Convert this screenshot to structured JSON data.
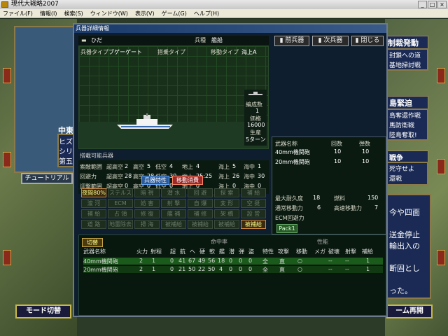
{
  "window": {
    "title": "現代大戦略2007"
  },
  "menu": [
    "ファイル(F)",
    "情報(I)",
    "検索(S)",
    "ウィンドウ(W)",
    "表示(V)",
    "ゲーム(G)",
    "ヘルプ(H)"
  ],
  "dialog": {
    "title": "兵器詳細情報",
    "name": "ひだ",
    "type_label": "兵種",
    "type_value": "艦船",
    "weapon_type_label": "兵器タイプ",
    "weapon_type_value": "ブゲーゲート",
    "board_type_label": "搭乗タイプ",
    "move_type_label": "移動タイプ",
    "move_type_value": "海上A",
    "formation_label": "編成数",
    "formation_value": "1",
    "price_label": "価格",
    "price_value": "16000",
    "production_label": "生産",
    "production_value": "5ターン",
    "carry_label": "搭載可能兵器",
    "prev_button": "前兵器",
    "next_button": "次兵器",
    "close_button": "閉じる"
  },
  "stats": [
    {
      "label": "索敵範囲",
      "a": "超高空",
      "av": "2",
      "b": "高空",
      "bv": "5",
      "c": "低空",
      "cv": "4",
      "d": "地上",
      "dv": "4",
      "e": "海上",
      "ev": "5",
      "f": "海中",
      "fv": "1"
    },
    {
      "label": "回避力",
      "a": "超高空",
      "av": "28",
      "b": "高空",
      "bv": "28",
      "c": "低空",
      "cv": "30",
      "d": "地上",
      "dv": "25:25",
      "e": "海上",
      "ev": "26",
      "f": "海中",
      "fv": "30"
    },
    {
      "label": "迎撃範囲",
      "a": "超高空",
      "av": "0",
      "b": "高空",
      "bv": "0",
      "c": "低空",
      "cv": "0",
      "d": "地上",
      "dv": "0",
      "e": "海上",
      "ev": "0",
      "f": "海中",
      "fv": "0"
    }
  ],
  "tabs": {
    "spec": "兵器特性",
    "move_cost": "移動消費"
  },
  "chips": [
    [
      "夜間80%",
      "ステルス",
      "暗 視",
      "潜 水",
      "回 避",
      "探 索",
      "補 給"
    ],
    [
      "渡 河",
      "ECM",
      "妨 害",
      "射 撃",
      "自 爆",
      "変 形",
      "空 挺"
    ],
    [
      "補 給",
      "占 領",
      "修 復",
      "艦 補",
      "補 修",
      "架 橋",
      "設 営"
    ],
    [
      "道 路",
      "地雷除去",
      "掃 海",
      "被補給",
      "被補給",
      "被補給",
      "被補給"
    ]
  ],
  "weapons_summary": {
    "headers": [
      "武器名称",
      "回数",
      "弾数"
    ],
    "rows": [
      [
        "40mm機関砲",
        "10",
        "10"
      ],
      [
        "20mm機関砲",
        "10",
        "10"
      ]
    ],
    "durability_label": "最大耐久度",
    "durability_value": "18",
    "fuel_label": "燃料",
    "fuel_value": "150",
    "normal_move_label": "通常移動力",
    "normal_move_value": "6",
    "fast_move_label": "高速移動力",
    "fast_move_value": "7",
    "ecm_label": "ECM回避力",
    "pack_label": "Pack1"
  },
  "weapons_detail": {
    "toggle": "切替",
    "accuracy_label": "命中率",
    "perf_label": "性能",
    "headers": [
      "武器名称",
      "火力",
      "射程",
      "超",
      "航",
      "ヘ",
      "硬",
      "軟",
      "艦",
      "潜",
      "弾",
      "盗",
      "特性",
      "攻撃",
      "移動",
      "メガ",
      "破壊",
      "射撃",
      "補給"
    ],
    "rows": [
      [
        "40mm機関砲",
        "2",
        "1",
        "0",
        "41",
        "67",
        "49",
        "56",
        "18",
        "0",
        "0",
        "0",
        "全",
        "直",
        "○",
        "",
        "--",
        "--",
        "1"
      ],
      [
        "20mm機関砲",
        "2",
        "1",
        "0",
        "21",
        "50",
        "22",
        "50",
        "4",
        "0",
        "0",
        "0",
        "全",
        "直",
        "○",
        "",
        "--",
        "--",
        "1"
      ]
    ]
  },
  "side": {
    "left_labels": [
      "中東",
      "ヒズ",
      "シリ",
      "第五"
    ],
    "tutorial": "チュートリアル",
    "mode_switch": "モード切替",
    "right_top": "制裁発動",
    "right_items": [
      "封鎖への道",
      "基地掃討戦"
    ],
    "right_bar": "島緊迫",
    "right_list": [
      "島奪還作戦",
      "馬防衛戦",
      "陸島奪取!"
    ],
    "right_war": "戦争",
    "right_list2": [
      "死守せよ",
      "還戦"
    ],
    "right_text": [
      "今や四面",
      "送金停止",
      "輸出入の",
      "断固とし",
      "った。"
    ],
    "resume": "ーム再開"
  },
  "colors": {
    "accent": "#c8b84a",
    "titlebar": "#1a3a6a",
    "highlight": "#1a5a1a"
  }
}
